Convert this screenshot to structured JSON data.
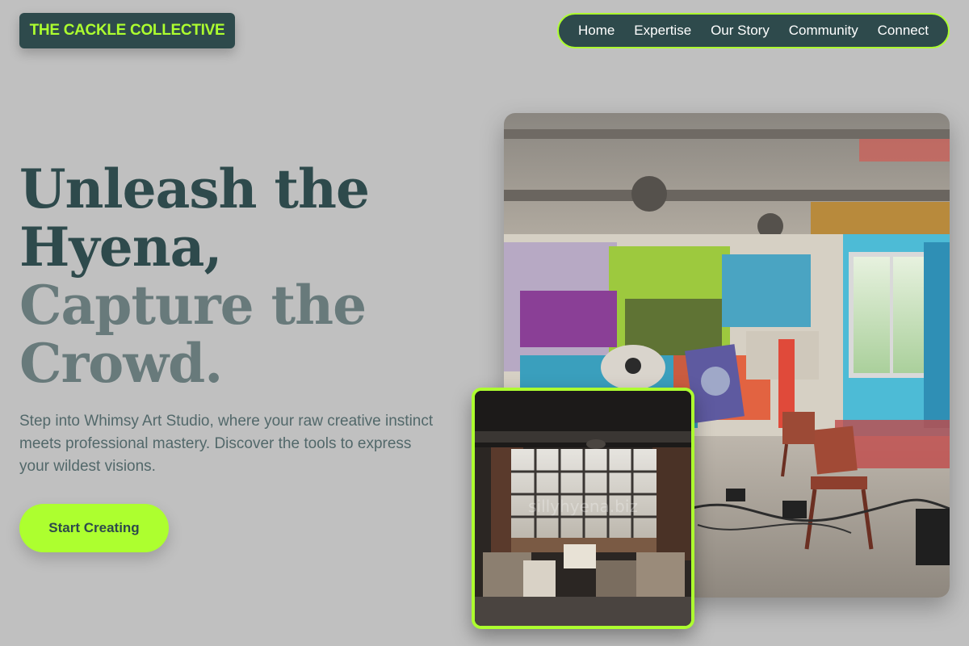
{
  "brand": {
    "logo_text": "THE CACKLE COLLECTIVE",
    "accent_color": "#adff2f",
    "dark_color": "#2e4a4c"
  },
  "nav": {
    "items": [
      {
        "label": "Home"
      },
      {
        "label": "Expertise"
      },
      {
        "label": "Our Story"
      },
      {
        "label": "Community"
      },
      {
        "label": "Connect"
      }
    ]
  },
  "hero": {
    "headline_line1": "Unleash the",
    "headline_line2": "Hyena,",
    "headline_line3": "Capture the",
    "headline_line4": "Crowd.",
    "description": "Step into Whimsy Art Studio, where your raw creative instinct meets professional mastery. Discover the tools to express your wildest visions.",
    "cta_label": "Start Creating"
  },
  "images": {
    "main_image_watermark": "",
    "small_image_watermark": "sillyhyena.biz"
  }
}
